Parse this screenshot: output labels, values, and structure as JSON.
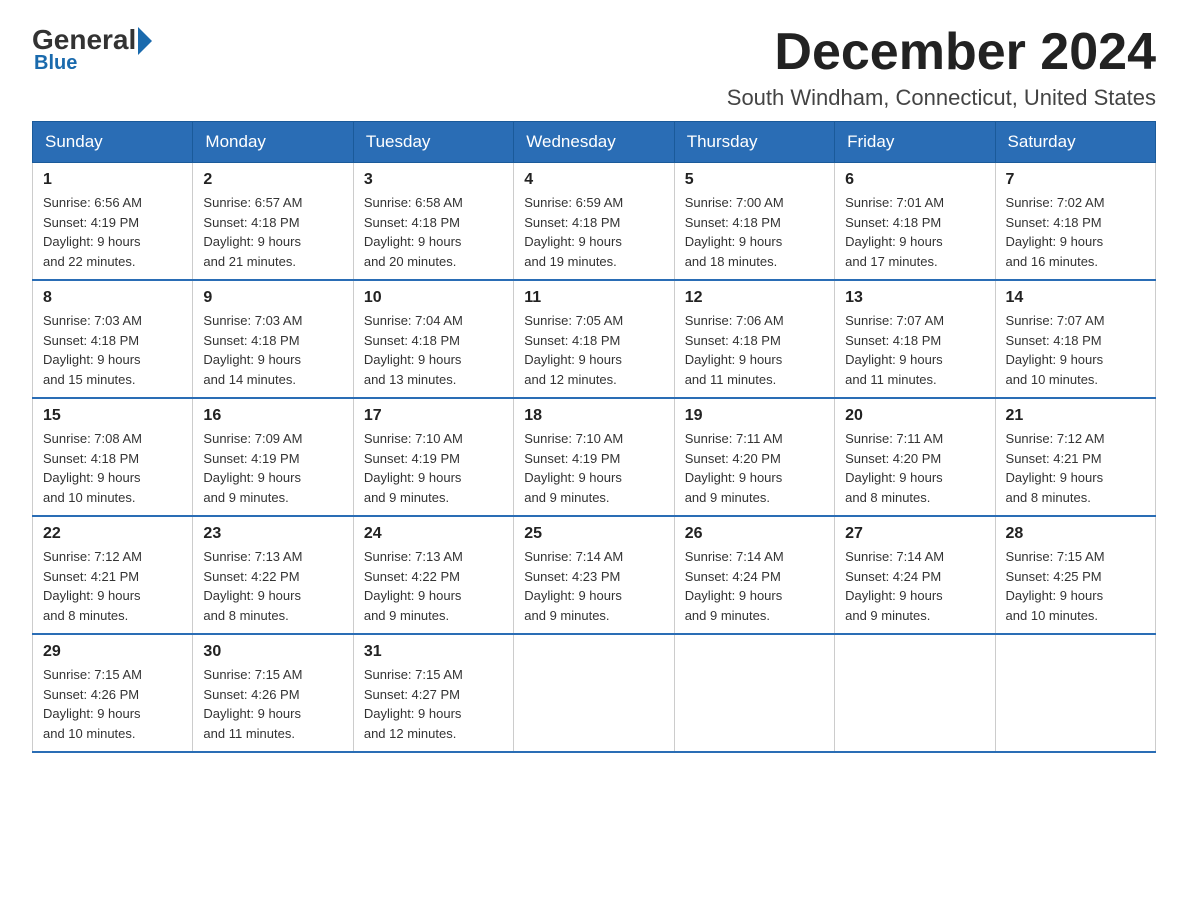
{
  "logo": {
    "general": "General",
    "blue": "Blue"
  },
  "title": "December 2024",
  "location": "South Windham, Connecticut, United States",
  "weekdays": [
    "Sunday",
    "Monday",
    "Tuesday",
    "Wednesday",
    "Thursday",
    "Friday",
    "Saturday"
  ],
  "weeks": [
    [
      {
        "day": "1",
        "sunrise": "6:56 AM",
        "sunset": "4:19 PM",
        "daylight": "9 hours and 22 minutes."
      },
      {
        "day": "2",
        "sunrise": "6:57 AM",
        "sunset": "4:18 PM",
        "daylight": "9 hours and 21 minutes."
      },
      {
        "day": "3",
        "sunrise": "6:58 AM",
        "sunset": "4:18 PM",
        "daylight": "9 hours and 20 minutes."
      },
      {
        "day": "4",
        "sunrise": "6:59 AM",
        "sunset": "4:18 PM",
        "daylight": "9 hours and 19 minutes."
      },
      {
        "day": "5",
        "sunrise": "7:00 AM",
        "sunset": "4:18 PM",
        "daylight": "9 hours and 18 minutes."
      },
      {
        "day": "6",
        "sunrise": "7:01 AM",
        "sunset": "4:18 PM",
        "daylight": "9 hours and 17 minutes."
      },
      {
        "day": "7",
        "sunrise": "7:02 AM",
        "sunset": "4:18 PM",
        "daylight": "9 hours and 16 minutes."
      }
    ],
    [
      {
        "day": "8",
        "sunrise": "7:03 AM",
        "sunset": "4:18 PM",
        "daylight": "9 hours and 15 minutes."
      },
      {
        "day": "9",
        "sunrise": "7:03 AM",
        "sunset": "4:18 PM",
        "daylight": "9 hours and 14 minutes."
      },
      {
        "day": "10",
        "sunrise": "7:04 AM",
        "sunset": "4:18 PM",
        "daylight": "9 hours and 13 minutes."
      },
      {
        "day": "11",
        "sunrise": "7:05 AM",
        "sunset": "4:18 PM",
        "daylight": "9 hours and 12 minutes."
      },
      {
        "day": "12",
        "sunrise": "7:06 AM",
        "sunset": "4:18 PM",
        "daylight": "9 hours and 11 minutes."
      },
      {
        "day": "13",
        "sunrise": "7:07 AM",
        "sunset": "4:18 PM",
        "daylight": "9 hours and 11 minutes."
      },
      {
        "day": "14",
        "sunrise": "7:07 AM",
        "sunset": "4:18 PM",
        "daylight": "9 hours and 10 minutes."
      }
    ],
    [
      {
        "day": "15",
        "sunrise": "7:08 AM",
        "sunset": "4:18 PM",
        "daylight": "9 hours and 10 minutes."
      },
      {
        "day": "16",
        "sunrise": "7:09 AM",
        "sunset": "4:19 PM",
        "daylight": "9 hours and 9 minutes."
      },
      {
        "day": "17",
        "sunrise": "7:10 AM",
        "sunset": "4:19 PM",
        "daylight": "9 hours and 9 minutes."
      },
      {
        "day": "18",
        "sunrise": "7:10 AM",
        "sunset": "4:19 PM",
        "daylight": "9 hours and 9 minutes."
      },
      {
        "day": "19",
        "sunrise": "7:11 AM",
        "sunset": "4:20 PM",
        "daylight": "9 hours and 9 minutes."
      },
      {
        "day": "20",
        "sunrise": "7:11 AM",
        "sunset": "4:20 PM",
        "daylight": "9 hours and 8 minutes."
      },
      {
        "day": "21",
        "sunrise": "7:12 AM",
        "sunset": "4:21 PM",
        "daylight": "9 hours and 8 minutes."
      }
    ],
    [
      {
        "day": "22",
        "sunrise": "7:12 AM",
        "sunset": "4:21 PM",
        "daylight": "9 hours and 8 minutes."
      },
      {
        "day": "23",
        "sunrise": "7:13 AM",
        "sunset": "4:22 PM",
        "daylight": "9 hours and 8 minutes."
      },
      {
        "day": "24",
        "sunrise": "7:13 AM",
        "sunset": "4:22 PM",
        "daylight": "9 hours and 9 minutes."
      },
      {
        "day": "25",
        "sunrise": "7:14 AM",
        "sunset": "4:23 PM",
        "daylight": "9 hours and 9 minutes."
      },
      {
        "day": "26",
        "sunrise": "7:14 AM",
        "sunset": "4:24 PM",
        "daylight": "9 hours and 9 minutes."
      },
      {
        "day": "27",
        "sunrise": "7:14 AM",
        "sunset": "4:24 PM",
        "daylight": "9 hours and 9 minutes."
      },
      {
        "day": "28",
        "sunrise": "7:15 AM",
        "sunset": "4:25 PM",
        "daylight": "9 hours and 10 minutes."
      }
    ],
    [
      {
        "day": "29",
        "sunrise": "7:15 AM",
        "sunset": "4:26 PM",
        "daylight": "9 hours and 10 minutes."
      },
      {
        "day": "30",
        "sunrise": "7:15 AM",
        "sunset": "4:26 PM",
        "daylight": "9 hours and 11 minutes."
      },
      {
        "day": "31",
        "sunrise": "7:15 AM",
        "sunset": "4:27 PM",
        "daylight": "9 hours and 12 minutes."
      },
      null,
      null,
      null,
      null
    ]
  ],
  "labels": {
    "sunrise": "Sunrise:",
    "sunset": "Sunset:",
    "daylight": "Daylight:"
  }
}
